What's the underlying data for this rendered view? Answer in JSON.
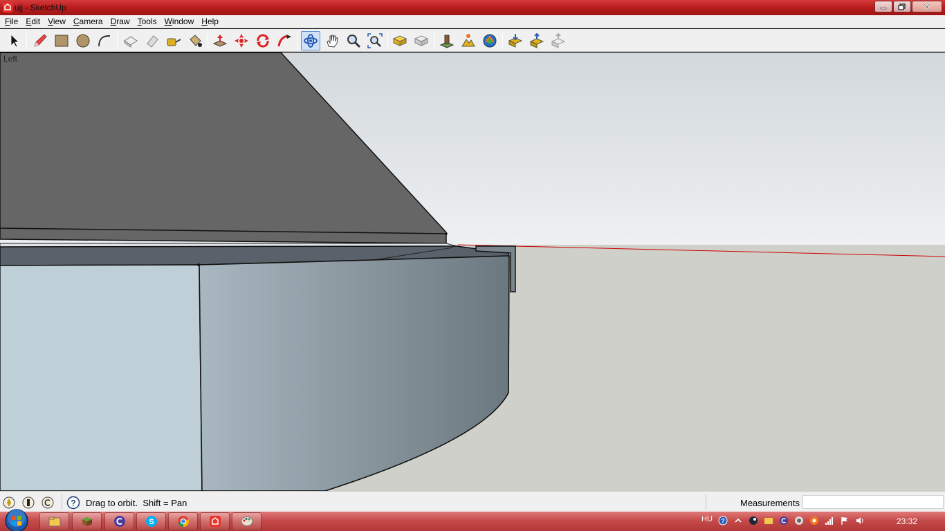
{
  "window": {
    "title": "ujj - SketchUp",
    "minimize_icon": "minimize-icon",
    "maximize_icon": "restore-icon",
    "close_icon": "close-icon"
  },
  "menu": {
    "items": [
      {
        "label": "File",
        "key": "F",
        "rest": "ile"
      },
      {
        "label": "Edit",
        "key": "E",
        "rest": "dit"
      },
      {
        "label": "View",
        "key": "V",
        "rest": "iew"
      },
      {
        "label": "Camera",
        "key": "C",
        "rest": "amera"
      },
      {
        "label": "Draw",
        "key": "D",
        "rest": "raw"
      },
      {
        "label": "Tools",
        "key": "T",
        "rest": "ools"
      },
      {
        "label": "Window",
        "key": "W",
        "rest": "indow"
      },
      {
        "label": "Help",
        "key": "H",
        "rest": "elp"
      }
    ]
  },
  "toolbar": {
    "tools": [
      {
        "name": "select-tool",
        "icon": "arrow-cursor-icon"
      },
      {
        "name": "line-tool",
        "icon": "pencil-icon"
      },
      {
        "name": "rectangle-tool",
        "icon": "rectangle-icon"
      },
      {
        "name": "circle-tool",
        "icon": "circle-icon"
      },
      {
        "name": "arc-tool",
        "icon": "arc-icon"
      },
      {
        "name": "make-component-tool",
        "icon": "component-icon"
      },
      {
        "name": "eraser-tool",
        "icon": "eraser-icon"
      },
      {
        "name": "tape-measure-tool",
        "icon": "tape-measure-icon"
      },
      {
        "name": "paint-bucket-tool",
        "icon": "paint-bucket-icon"
      },
      {
        "name": "push-pull-tool",
        "icon": "push-pull-icon"
      },
      {
        "name": "move-tool",
        "icon": "move-icon"
      },
      {
        "name": "rotate-tool",
        "icon": "rotate-icon"
      },
      {
        "name": "follow-me-tool",
        "icon": "follow-me-icon"
      },
      {
        "name": "orbit-tool",
        "icon": "orbit-icon",
        "active": true
      },
      {
        "name": "pan-tool",
        "icon": "hand-icon"
      },
      {
        "name": "zoom-tool",
        "icon": "magnifier-icon"
      },
      {
        "name": "zoom-extents-tool",
        "icon": "zoom-extents-icon"
      },
      {
        "name": "previous-view-tool",
        "icon": "previous-view-icon"
      },
      {
        "name": "next-view-tool",
        "icon": "next-view-icon"
      },
      {
        "name": "add-location-tool",
        "icon": "add-location-icon"
      },
      {
        "name": "toggle-terrain-tool",
        "icon": "terrain-icon"
      },
      {
        "name": "google-earth-tool",
        "icon": "earth-icon"
      },
      {
        "name": "get-models-tool",
        "icon": "get-models-icon"
      },
      {
        "name": "share-model-tool",
        "icon": "share-model-icon"
      },
      {
        "name": "share-component-tool",
        "icon": "share-component-icon"
      }
    ]
  },
  "viewport": {
    "view_label": "Left",
    "sky_top": "#d2d8dc",
    "sky_bottom": "#eef0f2",
    "ground": "#cfd0ca",
    "red_axis": "#cc0000"
  },
  "status": {
    "hint": "Drag to orbit.  Shift = Pan",
    "measurements_label": "Measurements",
    "measurements_value": ""
  },
  "taskbar": {
    "lang": "HU",
    "clock": "23:32",
    "apps": [
      {
        "name": "explorer",
        "icon": "folder-icon"
      },
      {
        "name": "minecraft",
        "icon": "grass-block-icon"
      },
      {
        "name": "app-c",
        "icon": "c-logo-icon"
      },
      {
        "name": "skype",
        "icon": "skype-icon"
      },
      {
        "name": "chrome",
        "icon": "chrome-icon"
      },
      {
        "name": "sketchup",
        "icon": "sketchup-icon"
      },
      {
        "name": "paint",
        "icon": "paint-palette-icon"
      }
    ]
  }
}
